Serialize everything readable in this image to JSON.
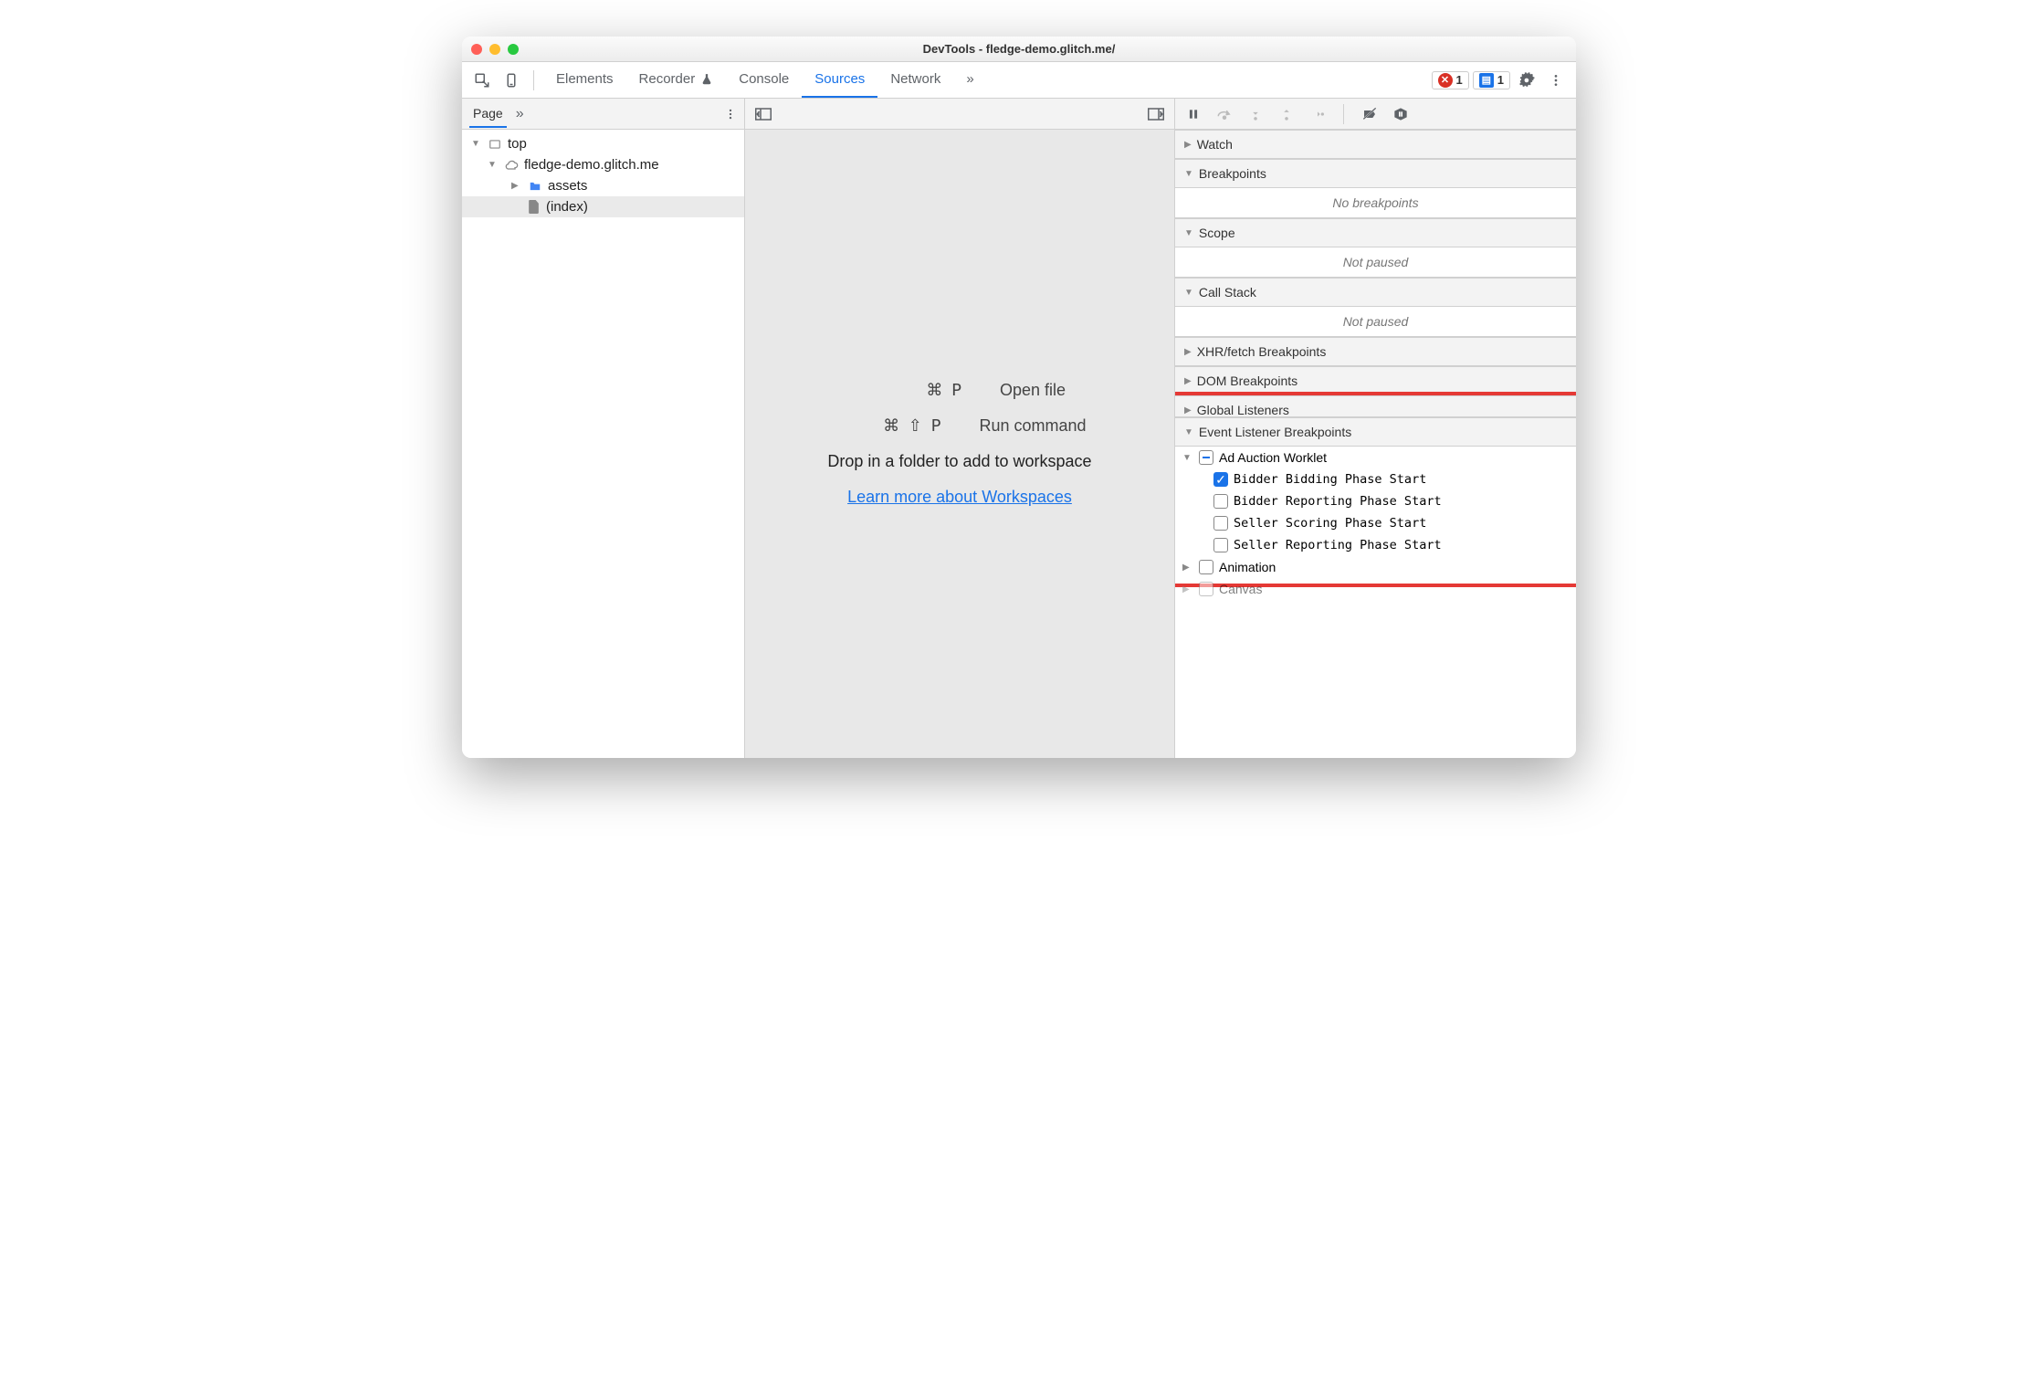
{
  "window": {
    "title": "DevTools - fledge-demo.glitch.me/"
  },
  "mainTabs": {
    "elements": "Elements",
    "recorder": "Recorder",
    "console": "Console",
    "sources": "Sources",
    "network": "Network"
  },
  "errorBadge": "1",
  "messageBadge": "1",
  "leftPanel": {
    "tab": "Page",
    "tree": {
      "top": "top",
      "origin": "fledge-demo.glitch.me",
      "assets": "assets",
      "index": "(index)"
    }
  },
  "center": {
    "openFileKeys": "⌘ P",
    "openFileLabel": "Open file",
    "runCmdKeys": "⌘ ⇧ P",
    "runCmdLabel": "Run command",
    "dropText": "Drop in a folder to add to workspace",
    "learnLink": "Learn more about Workspaces"
  },
  "right": {
    "watch": "Watch",
    "breakpoints": "Breakpoints",
    "noBreakpoints": "No breakpoints",
    "scope": "Scope",
    "notPaused": "Not paused",
    "callstack": "Call Stack",
    "xhr": "XHR/fetch Breakpoints",
    "dom": "DOM Breakpoints",
    "globalListeners": "Global Listeners",
    "eventListenerBP": "Event Listener Breakpoints",
    "adAuction": "Ad Auction Worklet",
    "items": {
      "bidderBidding": "Bidder Bidding Phase Start",
      "bidderReporting": "Bidder Reporting Phase Start",
      "sellerScoring": "Seller Scoring Phase Start",
      "sellerReporting": "Seller Reporting Phase Start"
    },
    "animation": "Animation",
    "canvas": "Canvas"
  }
}
